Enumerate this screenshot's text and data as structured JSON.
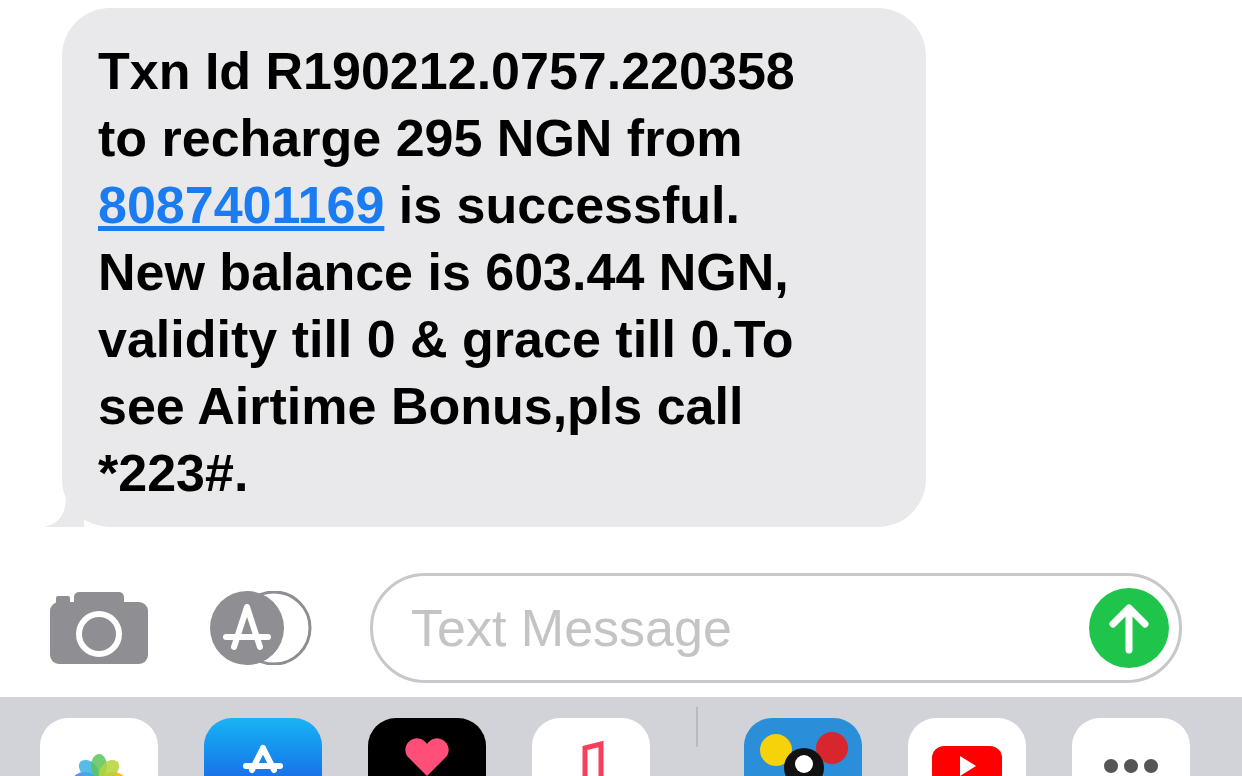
{
  "message": {
    "text_before": "Txn Id R190212.0757.220358 to recharge 295 NGN from",
    "link": "8087401169",
    "text_after": "is successful. New balance is 603.44 NGN, validity till 0 & grace till 0.To see Airtime Bonus,pls call *223#."
  },
  "composer": {
    "placeholder": "Text Message"
  },
  "apps": [
    {
      "kind": "photos"
    },
    {
      "kind": "store"
    },
    {
      "kind": "heart"
    },
    {
      "kind": "music"
    },
    {
      "kind": "divider"
    },
    {
      "kind": "billiards"
    },
    {
      "kind": "video"
    },
    {
      "kind": "more"
    }
  ]
}
